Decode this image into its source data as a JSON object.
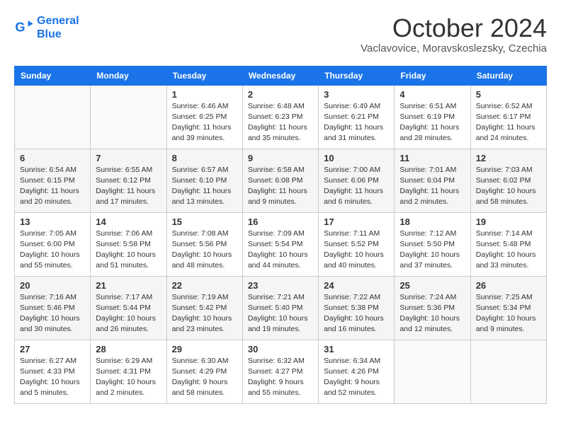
{
  "header": {
    "logo_line1": "General",
    "logo_line2": "Blue",
    "month_title": "October 2024",
    "location": "Vaclavovice, Moravskoslezsky, Czechia"
  },
  "days_of_week": [
    "Sunday",
    "Monday",
    "Tuesday",
    "Wednesday",
    "Thursday",
    "Friday",
    "Saturday"
  ],
  "weeks": [
    [
      {
        "day": "",
        "info": ""
      },
      {
        "day": "",
        "info": ""
      },
      {
        "day": "1",
        "info": "Sunrise: 6:46 AM\nSunset: 6:25 PM\nDaylight: 11 hours and 39 minutes."
      },
      {
        "day": "2",
        "info": "Sunrise: 6:48 AM\nSunset: 6:23 PM\nDaylight: 11 hours and 35 minutes."
      },
      {
        "day": "3",
        "info": "Sunrise: 6:49 AM\nSunset: 6:21 PM\nDaylight: 11 hours and 31 minutes."
      },
      {
        "day": "4",
        "info": "Sunrise: 6:51 AM\nSunset: 6:19 PM\nDaylight: 11 hours and 28 minutes."
      },
      {
        "day": "5",
        "info": "Sunrise: 6:52 AM\nSunset: 6:17 PM\nDaylight: 11 hours and 24 minutes."
      }
    ],
    [
      {
        "day": "6",
        "info": "Sunrise: 6:54 AM\nSunset: 6:15 PM\nDaylight: 11 hours and 20 minutes."
      },
      {
        "day": "7",
        "info": "Sunrise: 6:55 AM\nSunset: 6:12 PM\nDaylight: 11 hours and 17 minutes."
      },
      {
        "day": "8",
        "info": "Sunrise: 6:57 AM\nSunset: 6:10 PM\nDaylight: 11 hours and 13 minutes."
      },
      {
        "day": "9",
        "info": "Sunrise: 6:58 AM\nSunset: 6:08 PM\nDaylight: 11 hours and 9 minutes."
      },
      {
        "day": "10",
        "info": "Sunrise: 7:00 AM\nSunset: 6:06 PM\nDaylight: 11 hours and 6 minutes."
      },
      {
        "day": "11",
        "info": "Sunrise: 7:01 AM\nSunset: 6:04 PM\nDaylight: 11 hours and 2 minutes."
      },
      {
        "day": "12",
        "info": "Sunrise: 7:03 AM\nSunset: 6:02 PM\nDaylight: 10 hours and 58 minutes."
      }
    ],
    [
      {
        "day": "13",
        "info": "Sunrise: 7:05 AM\nSunset: 6:00 PM\nDaylight: 10 hours and 55 minutes."
      },
      {
        "day": "14",
        "info": "Sunrise: 7:06 AM\nSunset: 5:58 PM\nDaylight: 10 hours and 51 minutes."
      },
      {
        "day": "15",
        "info": "Sunrise: 7:08 AM\nSunset: 5:56 PM\nDaylight: 10 hours and 48 minutes."
      },
      {
        "day": "16",
        "info": "Sunrise: 7:09 AM\nSunset: 5:54 PM\nDaylight: 10 hours and 44 minutes."
      },
      {
        "day": "17",
        "info": "Sunrise: 7:11 AM\nSunset: 5:52 PM\nDaylight: 10 hours and 40 minutes."
      },
      {
        "day": "18",
        "info": "Sunrise: 7:12 AM\nSunset: 5:50 PM\nDaylight: 10 hours and 37 minutes."
      },
      {
        "day": "19",
        "info": "Sunrise: 7:14 AM\nSunset: 5:48 PM\nDaylight: 10 hours and 33 minutes."
      }
    ],
    [
      {
        "day": "20",
        "info": "Sunrise: 7:16 AM\nSunset: 5:46 PM\nDaylight: 10 hours and 30 minutes."
      },
      {
        "day": "21",
        "info": "Sunrise: 7:17 AM\nSunset: 5:44 PM\nDaylight: 10 hours and 26 minutes."
      },
      {
        "day": "22",
        "info": "Sunrise: 7:19 AM\nSunset: 5:42 PM\nDaylight: 10 hours and 23 minutes."
      },
      {
        "day": "23",
        "info": "Sunrise: 7:21 AM\nSunset: 5:40 PM\nDaylight: 10 hours and 19 minutes."
      },
      {
        "day": "24",
        "info": "Sunrise: 7:22 AM\nSunset: 5:38 PM\nDaylight: 10 hours and 16 minutes."
      },
      {
        "day": "25",
        "info": "Sunrise: 7:24 AM\nSunset: 5:36 PM\nDaylight: 10 hours and 12 minutes."
      },
      {
        "day": "26",
        "info": "Sunrise: 7:25 AM\nSunset: 5:34 PM\nDaylight: 10 hours and 9 minutes."
      }
    ],
    [
      {
        "day": "27",
        "info": "Sunrise: 6:27 AM\nSunset: 4:33 PM\nDaylight: 10 hours and 5 minutes."
      },
      {
        "day": "28",
        "info": "Sunrise: 6:29 AM\nSunset: 4:31 PM\nDaylight: 10 hours and 2 minutes."
      },
      {
        "day": "29",
        "info": "Sunrise: 6:30 AM\nSunset: 4:29 PM\nDaylight: 9 hours and 58 minutes."
      },
      {
        "day": "30",
        "info": "Sunrise: 6:32 AM\nSunset: 4:27 PM\nDaylight: 9 hours and 55 minutes."
      },
      {
        "day": "31",
        "info": "Sunrise: 6:34 AM\nSunset: 4:26 PM\nDaylight: 9 hours and 52 minutes."
      },
      {
        "day": "",
        "info": ""
      },
      {
        "day": "",
        "info": ""
      }
    ]
  ]
}
